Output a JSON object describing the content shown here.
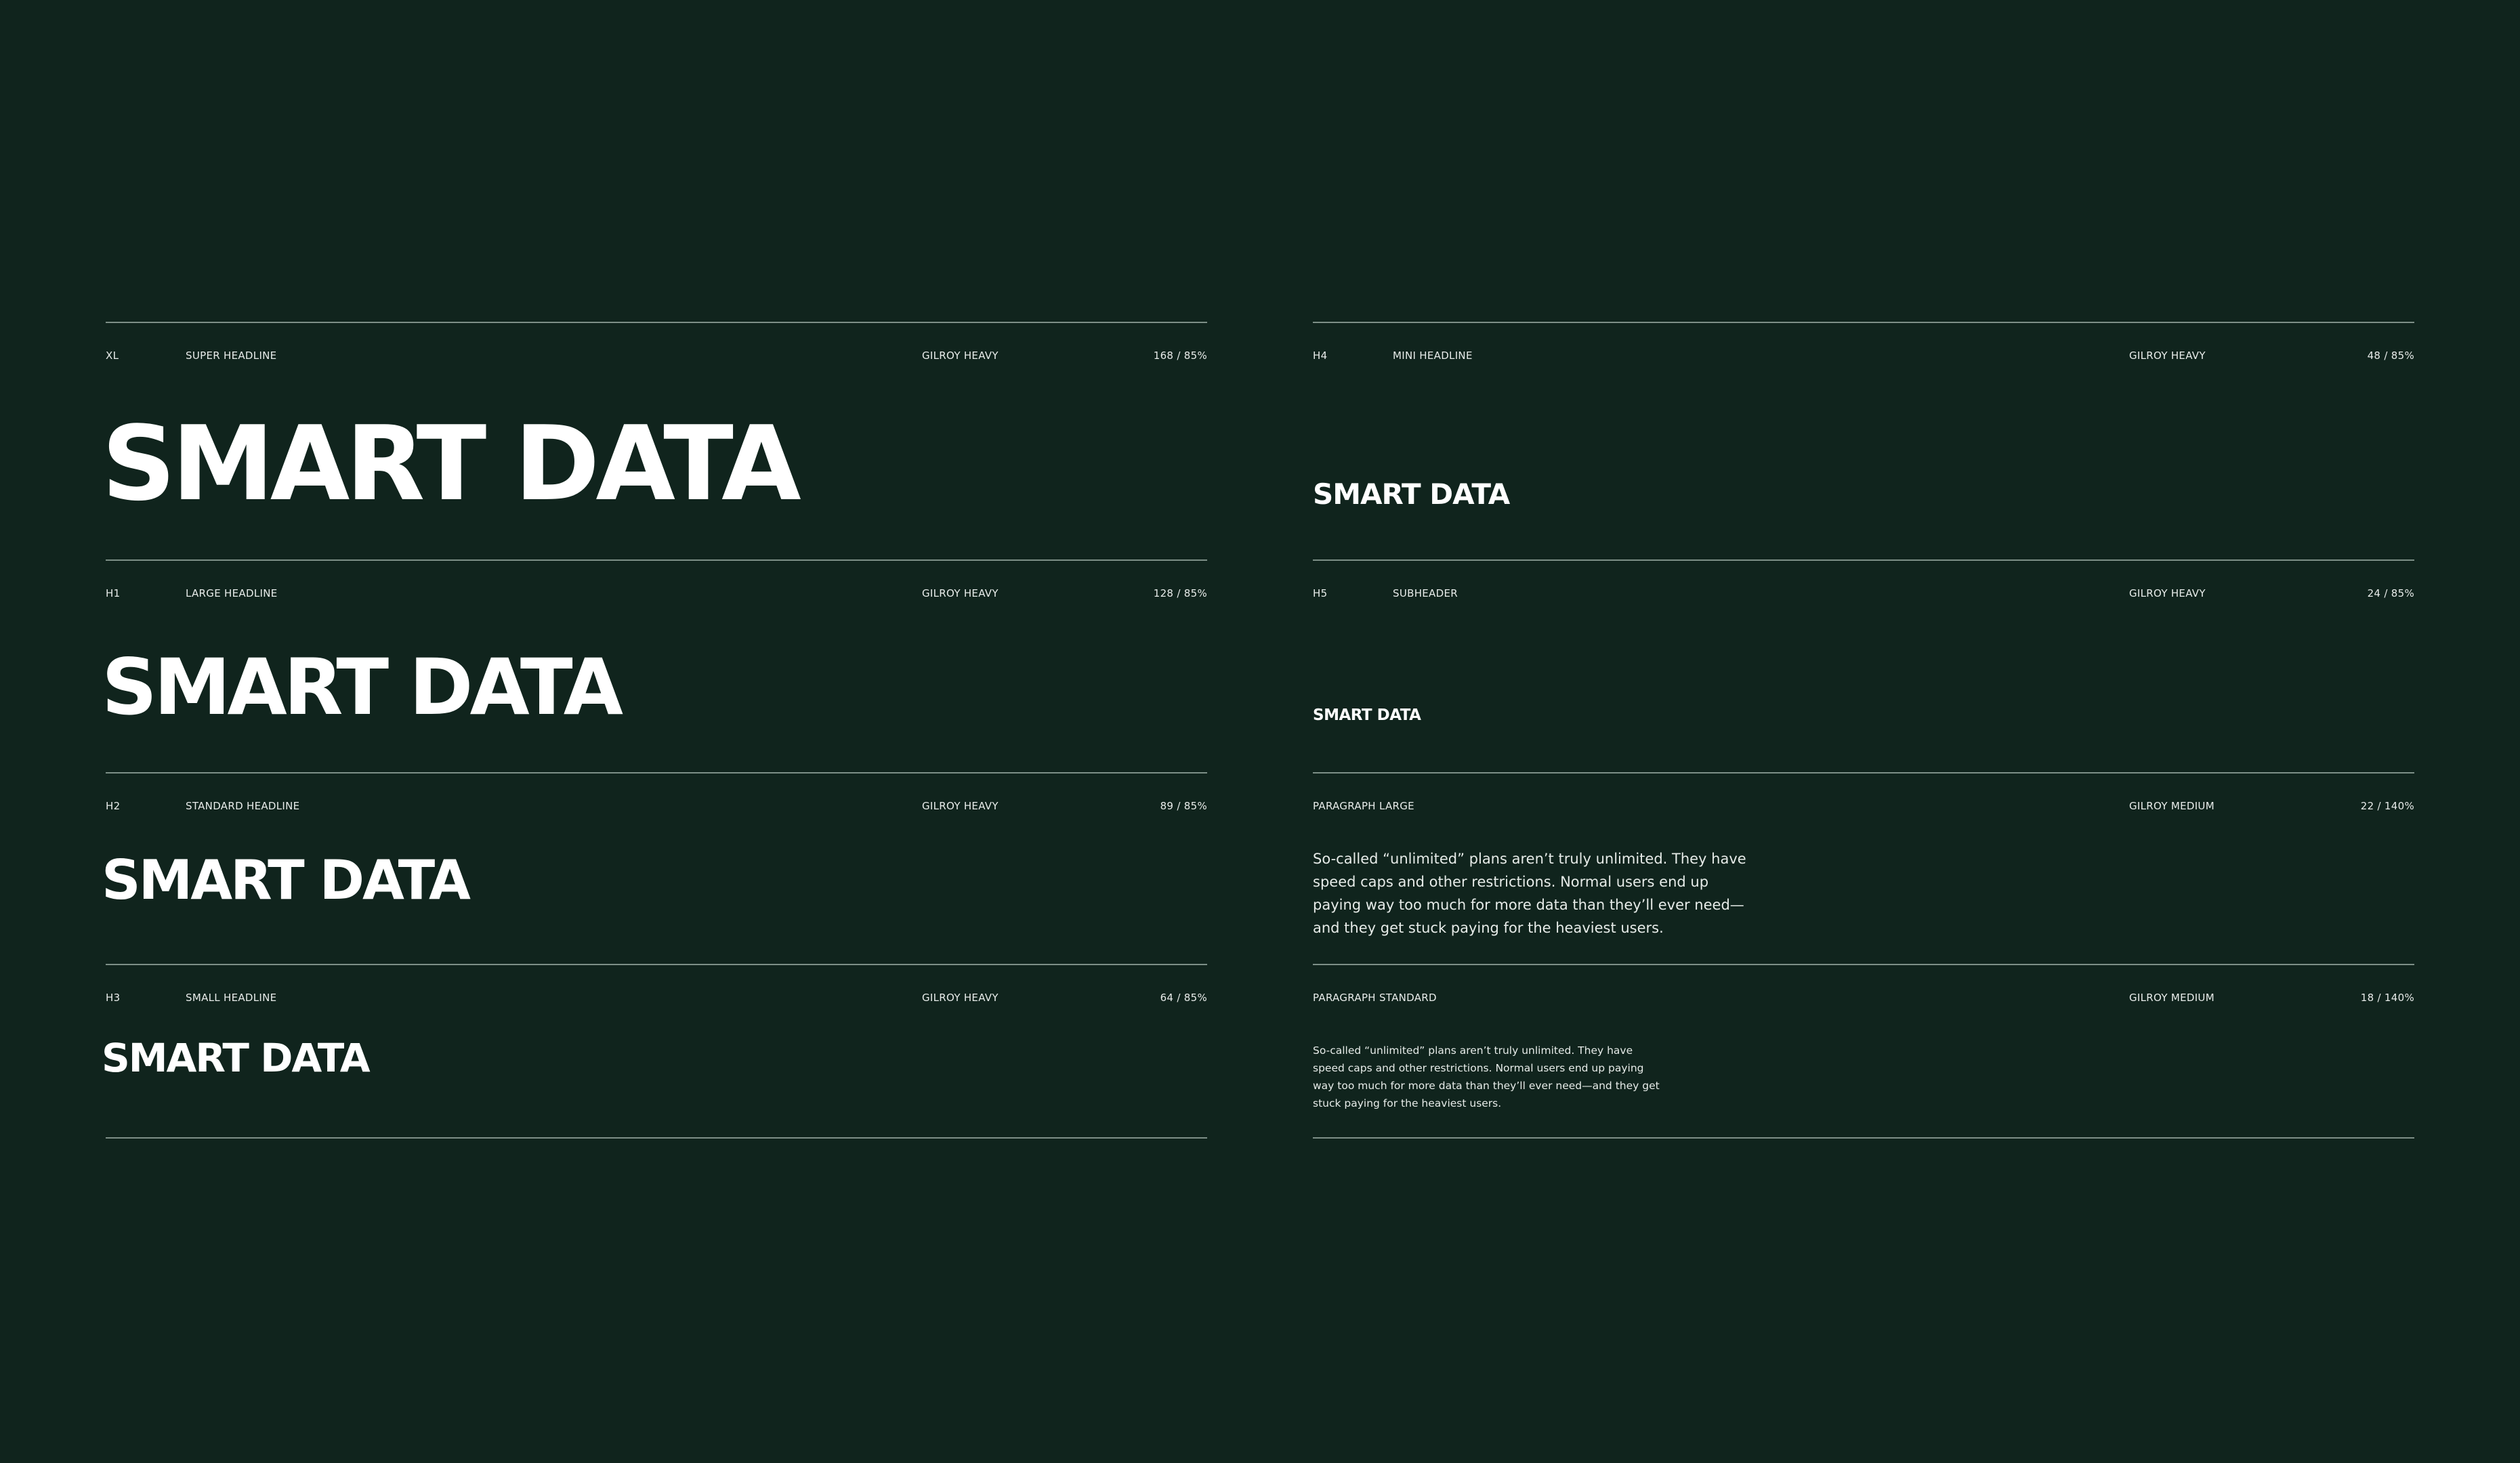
{
  "sections": {
    "xl": {
      "code": "XL",
      "name": "SUPER HEADLINE",
      "font": "GILROY HEAVY",
      "spec": "168 / 85%",
      "sample": "SMART DATA"
    },
    "h1": {
      "code": "H1",
      "name": "LARGE HEADLINE",
      "font": "GILROY HEAVY",
      "spec": "128 / 85%",
      "sample": "SMART DATA"
    },
    "h2": {
      "code": "H2",
      "name": "STANDARD HEADLINE",
      "font": "GILROY HEAVY",
      "spec": "89 / 85%",
      "sample": "SMART DATA"
    },
    "h3": {
      "code": "H3",
      "name": "SMALL HEADLINE",
      "font": "GILROY HEAVY",
      "spec": "64 / 85%",
      "sample": "SMART DATA"
    },
    "h4": {
      "code": "H4",
      "name": "MINI HEADLINE",
      "font": "GILROY HEAVY",
      "spec": "48 / 85%",
      "sample": "SMART DATA"
    },
    "h5": {
      "code": "H5",
      "name": "SUBHEADER",
      "font": "GILROY HEAVY",
      "spec": "24 / 85%",
      "sample": "SMART DATA"
    },
    "paragraph_large": {
      "name": "PARAGRAPH LARGE",
      "font": "GILROY MEDIUM",
      "spec": "22 / 140%",
      "sample": "So-called “unlimited” plans aren’t truly unlimited. They have speed caps and other restrictions. Normal users end up paying way too much for more data than they’ll ever need—and they get stuck paying for the heaviest users."
    },
    "paragraph_standard": {
      "name": "PARAGRAPH STANDARD",
      "font": "GILROY MEDIUM",
      "spec": "18 / 140%",
      "sample": "So-called “unlimited” plans aren’t truly unlimited. They have speed caps and other restrictions. Normal users end up paying way too much for more data than they’ll ever need—and they get stuck paying for the heaviest users."
    }
  }
}
